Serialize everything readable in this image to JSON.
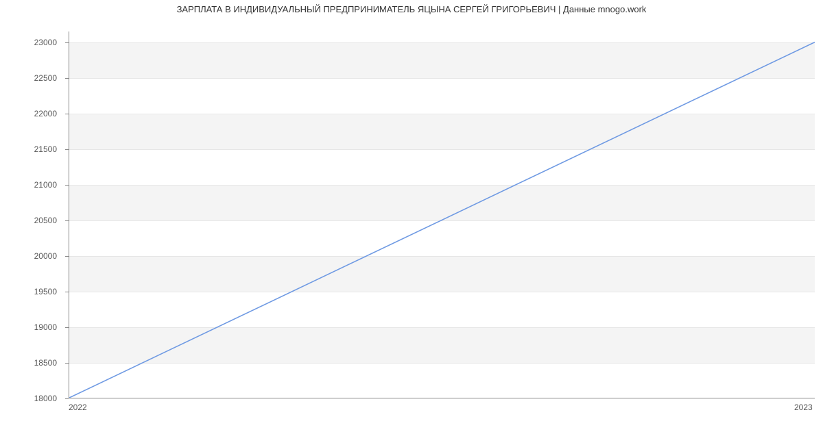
{
  "chart_data": {
    "type": "line",
    "title": "ЗАРПЛАТА В ИНДИВИДУАЛЬНЫЙ ПРЕДПРИНИМАТЕЛЬ ЯЦЫНА СЕРГЕЙ ГРИГОРЬЕВИЧ | Данные mnogo.work",
    "x": [
      "2022",
      "2023"
    ],
    "values": [
      18000,
      23000
    ],
    "x_tick_labels": [
      "2022",
      "2023"
    ],
    "y_tick_labels": [
      "18000",
      "18500",
      "19000",
      "19500",
      "20000",
      "20500",
      "21000",
      "21500",
      "22000",
      "22500",
      "23000"
    ],
    "ylim": [
      18000,
      23150
    ],
    "line_color": "#6f9ae3"
  }
}
